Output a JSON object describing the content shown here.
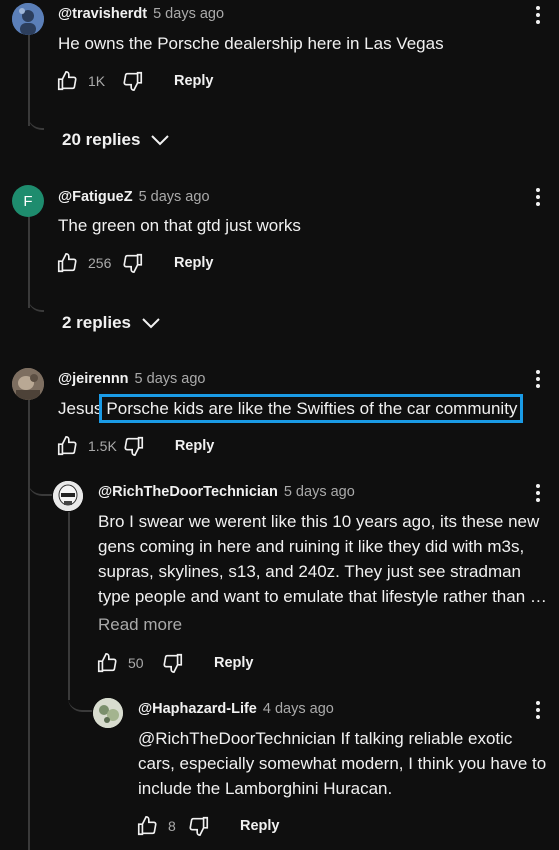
{
  "comments": [
    {
      "handle": "@travisherdt",
      "time": "5 days ago",
      "text": "He owns the Porsche dealership here in Las Vegas",
      "likes": "1K",
      "reply_label": "Reply",
      "replies_label": "20 replies",
      "avatar_color": "#4a6fa5"
    },
    {
      "handle": "@FatigueZ",
      "time": "5 days ago",
      "text": "The green on that gtd just works",
      "likes": "256",
      "reply_label": "Reply",
      "replies_label": "2 replies",
      "avatar_letter": "F",
      "avatar_color": "#1e8c6e"
    },
    {
      "handle": "@jeirennn",
      "time": "5 days ago",
      "text_prefix": "Jesus",
      "text_highlight": "Porsche kids are like the Swifties of the car community",
      "likes": "1.5K",
      "reply_label": "Reply",
      "avatar_color": "#8a7a6a"
    }
  ],
  "replies": [
    {
      "handle": "@RichTheDoorTechnician",
      "time": "5 days ago",
      "lines": [
        "Bro I swear we werent like this 10 years ago, its these new",
        "gens coming in here and ruining it like they did with m3s,",
        "supras, skylines, s13, and 240z. They just see stradman",
        "type people and want to emulate that lifestyle rather than …"
      ],
      "read_more": "Read more",
      "likes": "50",
      "reply_label": "Reply"
    },
    {
      "handle": "@Haphazard-Life",
      "time": "4 days ago",
      "lines": [
        "@RichTheDoorTechnician If talking reliable exotic",
        "cars, especially somewhat modern, I think you have to",
        "include the Lamborghini Huracan."
      ],
      "likes": "8",
      "reply_label": "Reply"
    }
  ],
  "colors": {
    "background": "#0f0f0f",
    "text": "#f1f1f1",
    "muted": "#aaaaaa",
    "highlight": "#1a9be6"
  }
}
